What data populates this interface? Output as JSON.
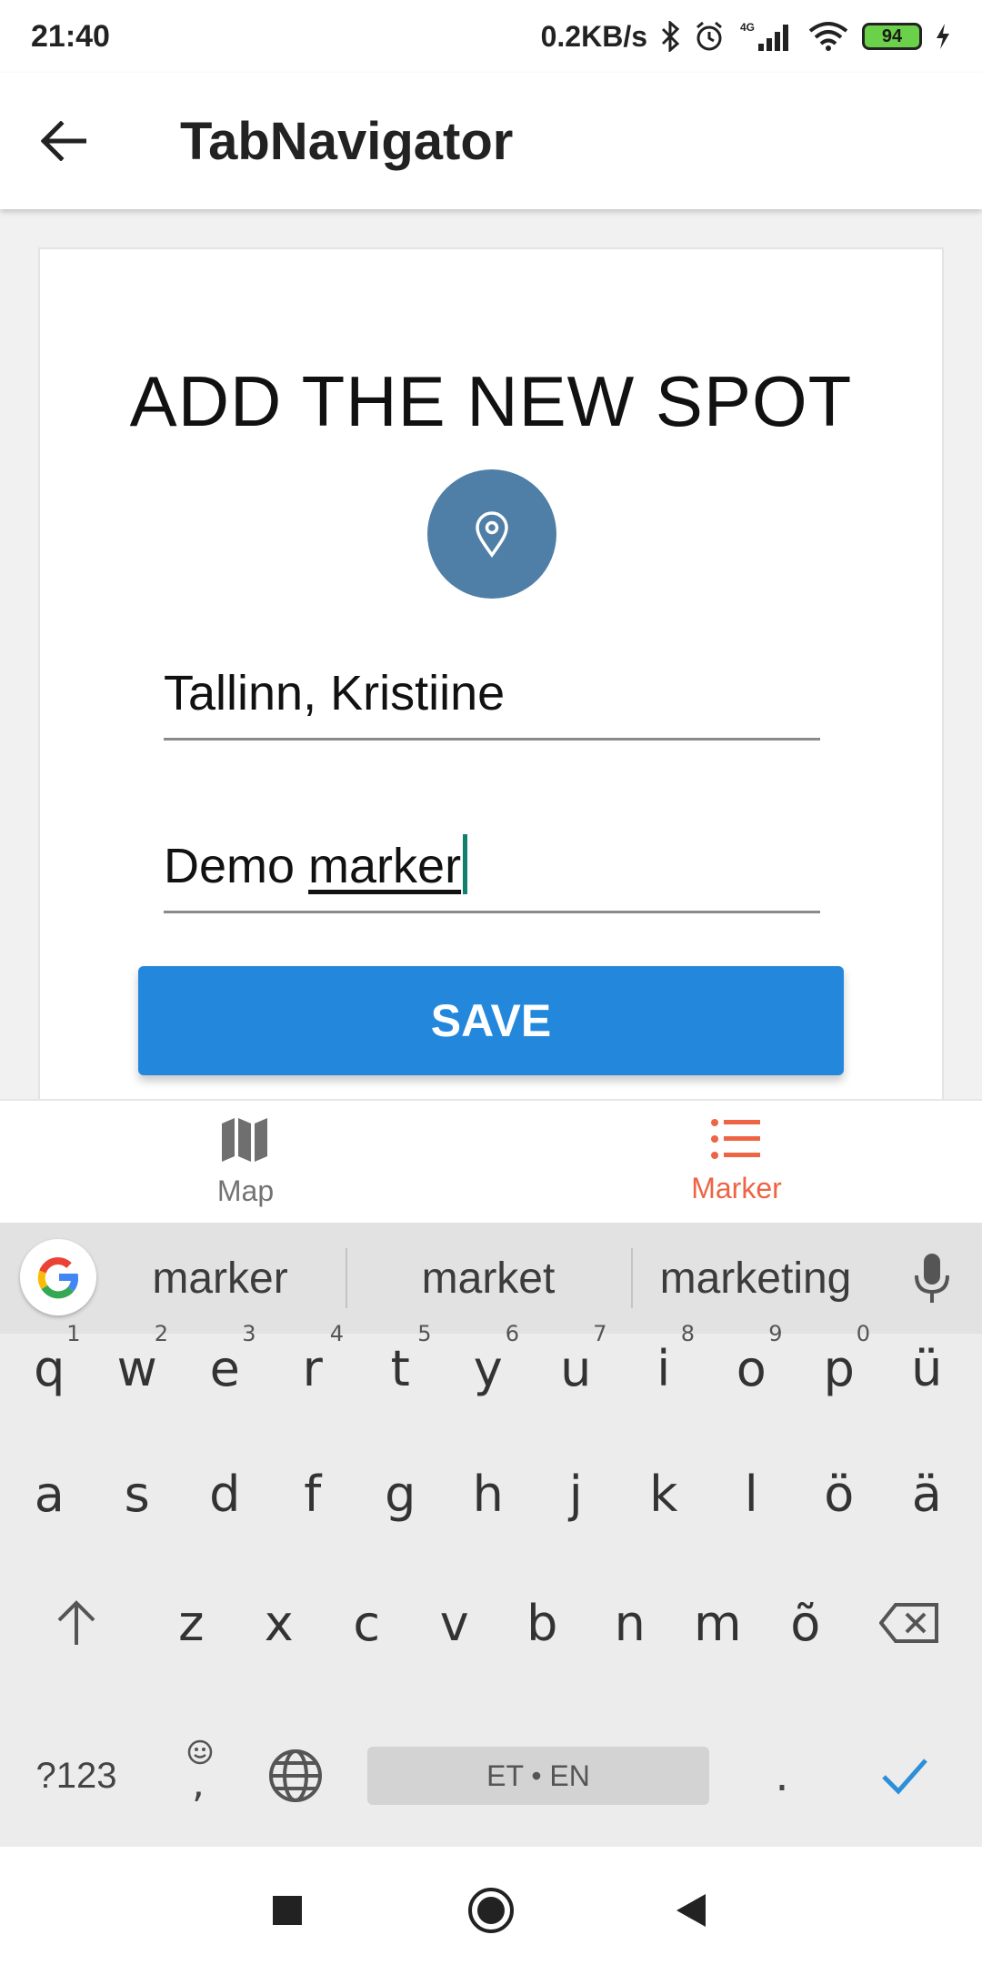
{
  "status": {
    "time": "21:40",
    "net_speed": "0.2KB/s",
    "network": "4G",
    "battery": "94"
  },
  "appbar": {
    "title": "TabNavigator"
  },
  "form": {
    "heading": "ADD THE NEW SPOT",
    "location_value": "Tallinn, Kristiine",
    "name_value_prefix": "Demo ",
    "name_value_underlined": "marker",
    "save_label": "SAVE"
  },
  "tabs": [
    {
      "label": "Map",
      "icon": "map-icon",
      "active": false
    },
    {
      "label": "Marker",
      "icon": "list-icon",
      "active": true
    }
  ],
  "colors": {
    "accent": "#2388db",
    "active_tab": "#ee6444",
    "pin_circle": "#4f7fa6"
  },
  "keyboard": {
    "suggestions": [
      "marker",
      "market",
      "marketing"
    ],
    "row1": [
      {
        "k": "q",
        "h": "1"
      },
      {
        "k": "w",
        "h": "2"
      },
      {
        "k": "e",
        "h": "3"
      },
      {
        "k": "r",
        "h": "4"
      },
      {
        "k": "t",
        "h": "5"
      },
      {
        "k": "y",
        "h": "6"
      },
      {
        "k": "u",
        "h": "7"
      },
      {
        "k": "i",
        "h": "8"
      },
      {
        "k": "o",
        "h": "9"
      },
      {
        "k": "p",
        "h": "0"
      },
      {
        "k": "ü",
        "h": ""
      }
    ],
    "row2": [
      "a",
      "s",
      "d",
      "f",
      "g",
      "h",
      "j",
      "k",
      "l",
      "ö",
      "ä"
    ],
    "row3": [
      "z",
      "x",
      "c",
      "v",
      "b",
      "n",
      "m",
      "õ"
    ],
    "symbols_label": "?123",
    "comma_label": ",",
    "space_label": "ET • EN",
    "period_label": "."
  }
}
